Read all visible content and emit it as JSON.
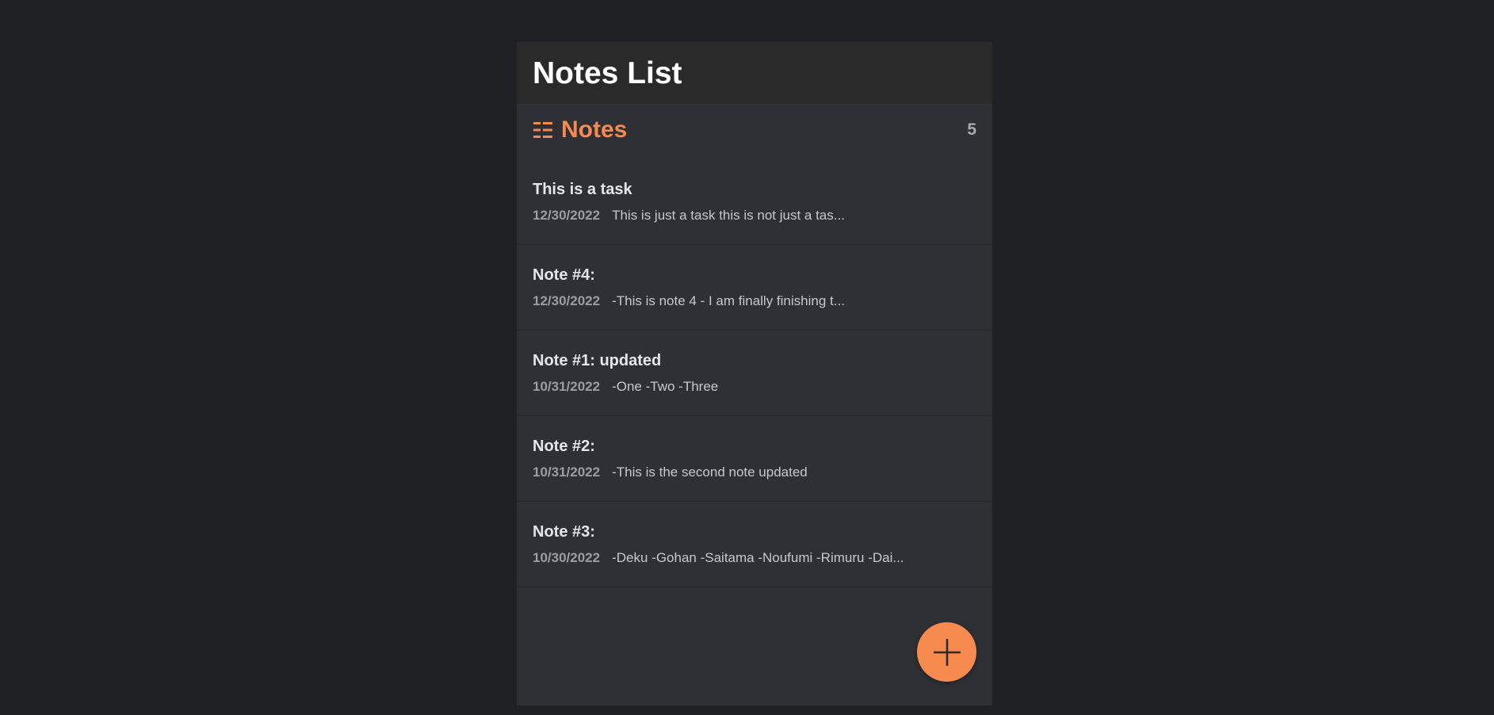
{
  "header": {
    "title": "Notes List"
  },
  "list": {
    "title": "Notes",
    "count": "5",
    "icon": "list-icon",
    "accent_color": "#f68a4f"
  },
  "notes": [
    {
      "title": "This is a task",
      "date": "12/30/2022",
      "preview": "This is just a task this is not just a tas..."
    },
    {
      "title": "Note #4:",
      "date": "12/30/2022",
      "preview": "-This is note 4 - I am finally finishing t..."
    },
    {
      "title": "Note #1: updated",
      "date": "10/31/2022",
      "preview": "-One -Two -Three"
    },
    {
      "title": "Note #2:",
      "date": "10/31/2022",
      "preview": "-This is the second note updated"
    },
    {
      "title": "Note #3:",
      "date": "10/30/2022",
      "preview": "-Deku -Gohan -Saitama -Noufumi -Rimuru -Dai..."
    }
  ],
  "fab": {
    "icon": "plus-icon",
    "color": "#f68a4f"
  }
}
